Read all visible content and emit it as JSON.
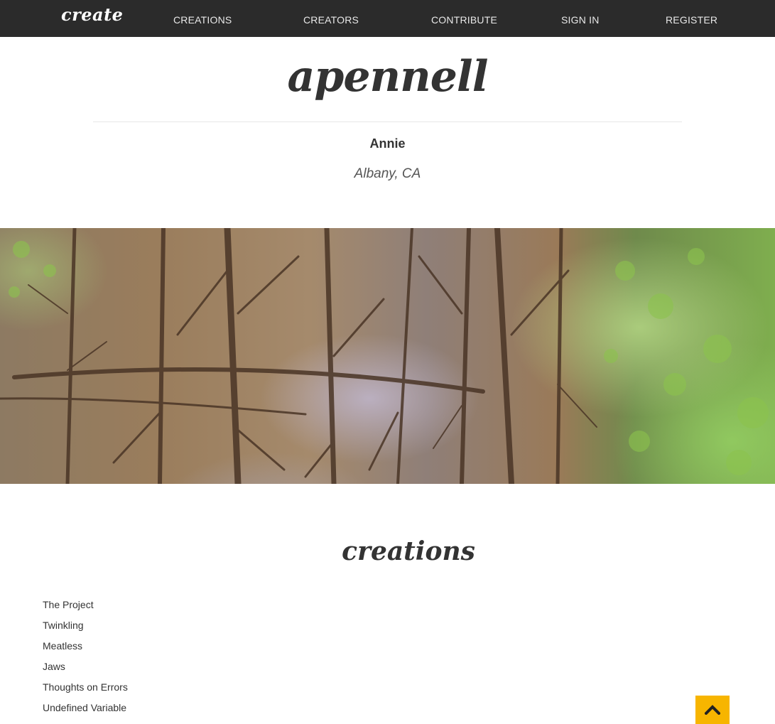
{
  "nav": {
    "brand": "create",
    "links": [
      "CREATIONS",
      "CREATORS",
      "CONTRIBUTE",
      "SIGN IN",
      "REGISTER"
    ]
  },
  "profile": {
    "username": "apennell",
    "name": "Annie",
    "location": "Albany, CA"
  },
  "banner": {
    "description_icon": "banner-photo"
  },
  "creations": {
    "title": "creations",
    "items": [
      "The Project",
      "Twinkling",
      "Meatless",
      "Jaws",
      "Thoughts on Errors",
      "Undefined Variable"
    ]
  },
  "back_to_top": {
    "icon": "chevron-up-icon",
    "color": "#f7b500"
  },
  "colors": {
    "navbar": "#2b2b2b",
    "text": "#333333",
    "accent": "#f7b500"
  }
}
